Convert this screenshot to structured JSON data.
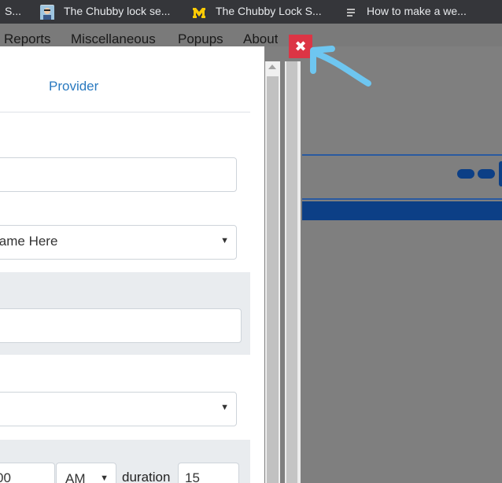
{
  "bookmarks": [
    {
      "label": "S...",
      "icon": "generic-favicon"
    },
    {
      "label": "The Chubby lock se...",
      "icon": "avatar-favicon"
    },
    {
      "label": "The Chubby Lock S...",
      "icon": "umich-favicon"
    },
    {
      "label": "How to make a we...",
      "icon": "document-favicon"
    }
  ],
  "nav": {
    "items": [
      "Reports",
      "Miscellaneous",
      "Popups",
      "About"
    ]
  },
  "modal": {
    "tab_provider": "Provider",
    "select_name": "lame Here",
    "time_value": "00",
    "ampm_value": "AM",
    "duration_label": "duration",
    "duration_value": "15"
  },
  "close_button": {
    "glyph": "✖",
    "color": "#dc3545"
  },
  "annotation": {
    "color": "#6ec6f0"
  }
}
